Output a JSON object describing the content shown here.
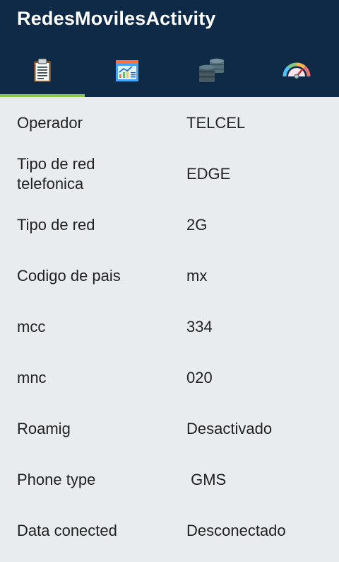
{
  "app": {
    "title": "RedesMovilesActivity"
  },
  "tabs": [
    {
      "icon": "clipboard-icon",
      "selected": true
    },
    {
      "icon": "chart-report-icon",
      "selected": false
    },
    {
      "icon": "database-icon",
      "selected": false
    },
    {
      "icon": "speedometer-icon",
      "selected": false
    }
  ],
  "colors": {
    "appbar": "#0f2a47",
    "indicator": "#8bc34a",
    "background": "#e9ecef"
  },
  "info": {
    "rows": [
      {
        "label": "Operador",
        "value": "TELCEL"
      },
      {
        "label": "Tipo de red telefonica",
        "value": "EDGE"
      },
      {
        "label": "Tipo de red",
        "value": "2G"
      },
      {
        "label": "Codigo de pais",
        "value": "mx"
      },
      {
        "label": "mcc",
        "value": "334"
      },
      {
        "label": "mnc",
        "value": "020"
      },
      {
        "label": "Roamig",
        "value": "Desactivado"
      },
      {
        "label": "Phone type",
        "value": " GMS"
      },
      {
        "label": "Data conected",
        "value": "Desconectado"
      }
    ]
  }
}
